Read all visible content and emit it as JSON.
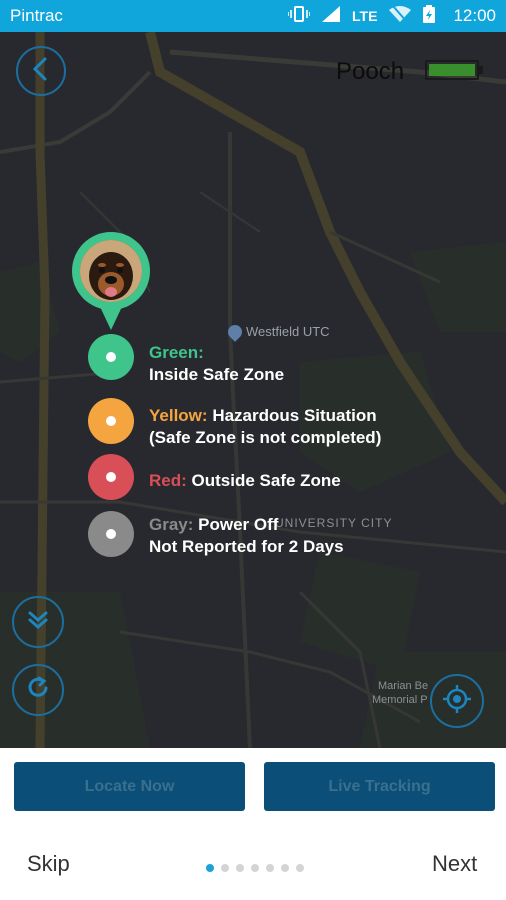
{
  "status_bar": {
    "app_name": "Pintrac",
    "lte_label": "LTE",
    "time": "12:00"
  },
  "map": {
    "labels": {
      "westfield": "Westfield UTC",
      "university": "UNIVERSITY CITY",
      "marian": "Marian Be",
      "memorial": "Memorial P"
    }
  },
  "header": {
    "pet_name": "Pooch",
    "battery_level": 1.0
  },
  "legend": [
    {
      "key": "Green:",
      "line1_rest": "",
      "line2": "Inside Safe Zone",
      "color": "#3fc48b"
    },
    {
      "key": "Yellow:",
      "line1_rest": "Hazardous Situation",
      "line2": "(Safe Zone is not completed)",
      "color": "#f5a540"
    },
    {
      "key": "Red:",
      "line1_rest": "Outside Safe Zone",
      "line2": "",
      "color": "#d94f58"
    },
    {
      "key": "Gray:",
      "line1_rest": "Power Off",
      "line2": "Not Reported for 2 Days",
      "color": "#8a8a8a"
    }
  ],
  "buttons": {
    "locate_now": "Locate Now",
    "live_tracking": "Live Tracking"
  },
  "footer": {
    "skip": "Skip",
    "next": "Next",
    "page_count": 7,
    "active_page": 1
  },
  "colors": {
    "status_bar": "#10a6dc",
    "accent_blue": "#1b86bf",
    "green": "#3fc48b",
    "yellow": "#f5a540",
    "red": "#d94f58",
    "gray": "#8a8a8a"
  },
  "icons": {
    "back": "back-arrow-icon",
    "collapse": "double-chevron-down-icon",
    "refresh": "refresh-icon",
    "locate": "crosshair-icon"
  }
}
